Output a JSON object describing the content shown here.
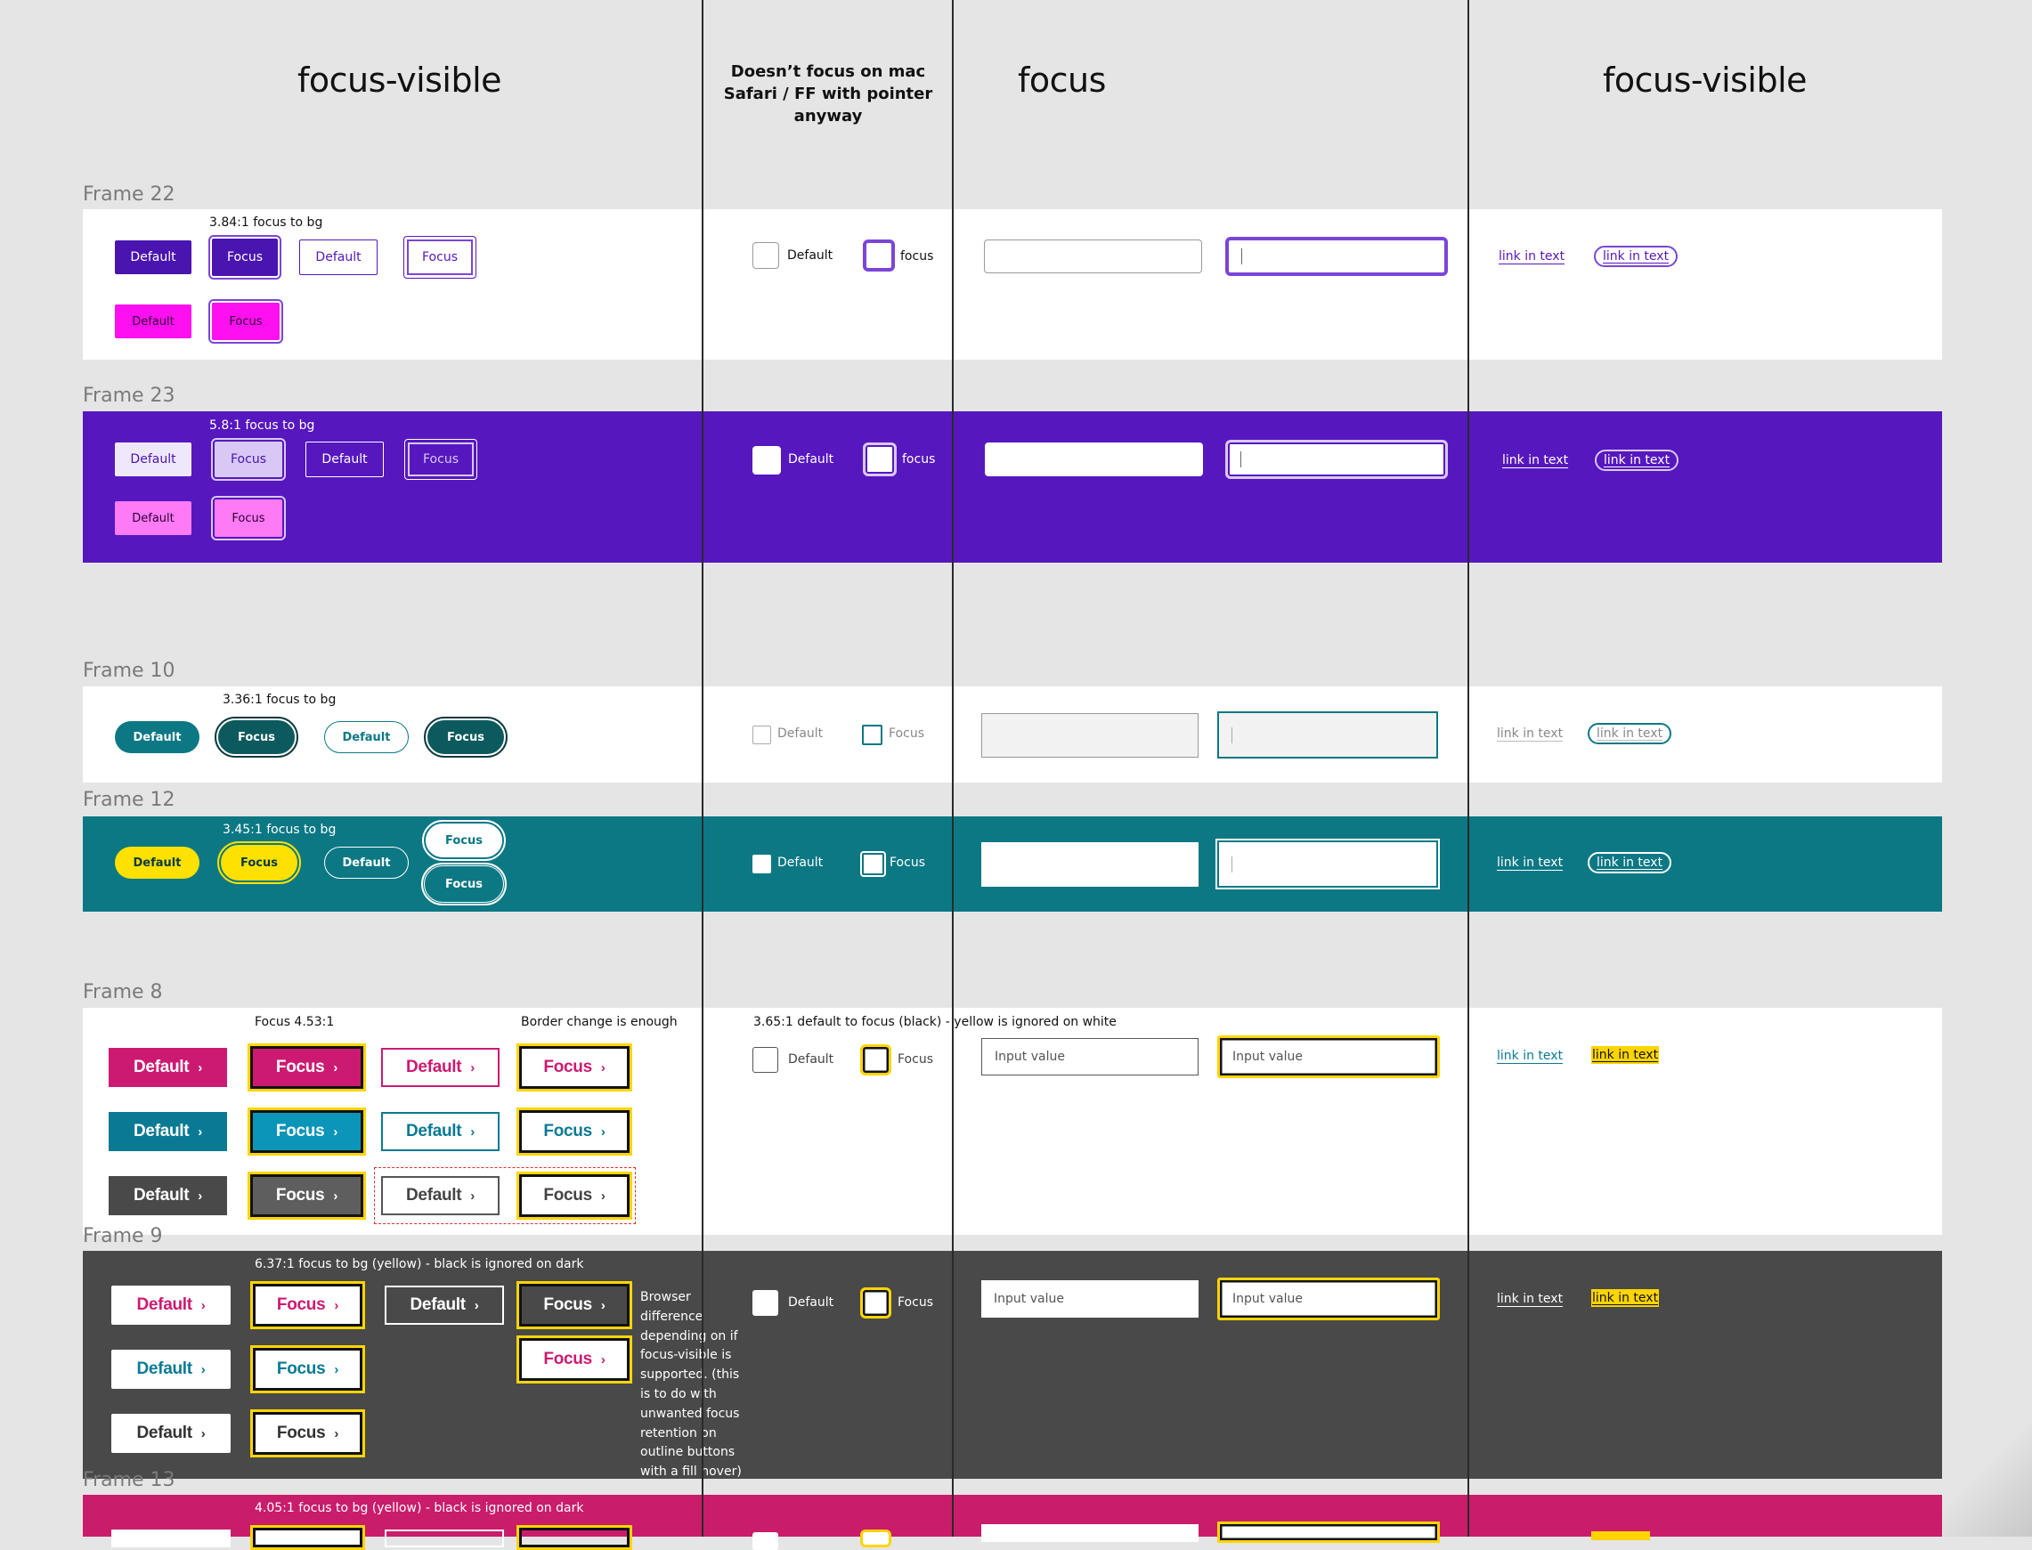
{
  "headers": {
    "col1": "focus-visible",
    "col2": "Doesn’t focus on mac Safari / FF with pointer anyway",
    "col3": "focus",
    "col4": "focus-visible"
  },
  "frames": {
    "f22": {
      "label": "Frame 22",
      "note": "3.84:1 focus to bg",
      "buttons": [
        "Default",
        "Focus",
        "Default",
        "Focus",
        "Default",
        "Focus"
      ],
      "checkbox_default": "Default",
      "checkbox_focus": "focus",
      "links": [
        "link in text",
        "link in text"
      ]
    },
    "f23": {
      "label": "Frame 23",
      "note": "5.8:1 focus to bg",
      "buttons": [
        "Default",
        "Focus",
        "Default",
        "Focus",
        "Default",
        "Focus"
      ],
      "checkbox_default": "Default",
      "checkbox_focus": "focus",
      "links": [
        "link in text",
        "link in text"
      ]
    },
    "f10": {
      "label": "Frame 10",
      "note": "3.36:1 focus to bg",
      "buttons": [
        "Default",
        "Focus",
        "Default",
        "Focus"
      ],
      "checkbox_default": "Default",
      "checkbox_focus": "Focus",
      "links": [
        "link in text",
        "link in text"
      ]
    },
    "f12": {
      "label": "Frame 12",
      "note": "3.45:1 focus to bg",
      "buttons": [
        "Default",
        "Focus",
        "Default",
        "Focus",
        "Focus"
      ],
      "checkbox_default": "Default",
      "checkbox_focus": "Focus",
      "links": [
        "link in text",
        "link in text"
      ]
    },
    "f8": {
      "label": "Frame 8",
      "note_focus": "Focus 4.53:1",
      "note_border": "Border change is enough",
      "note_checkbox": "3.65:1 default to focus (black) - yellow is ignored on white",
      "buttons": [
        "Default",
        "Focus",
        "Default",
        "Focus",
        "Default",
        "Focus",
        "Default",
        "Focus",
        "Default",
        "Focus",
        "Default",
        "Focus"
      ],
      "checkbox_default": "Default",
      "checkbox_focus": "Focus",
      "input_value": "Input value",
      "links": [
        "link in text",
        "link in text"
      ]
    },
    "f9": {
      "label": "Frame 9",
      "note": "6.37:1 focus to bg (yellow) - black is ignored on dark",
      "buttons": [
        "Default",
        "Focus",
        "Default",
        "Focus",
        "Focus",
        "Default",
        "Focus",
        "Default",
        "Focus"
      ],
      "side_note": "Browser difference depending on if focus-visible is supported. (this is to do with unwanted focus retention on outline buttons with a fill hover)",
      "checkbox_default": "Default",
      "checkbox_focus": "Focus",
      "input_value": "Input value",
      "links": [
        "link in text",
        "link in text"
      ]
    },
    "f13": {
      "label": "Frame 13",
      "note": "4.05:1 focus to bg (yellow) - black is ignored on dark"
    }
  },
  "colors": {
    "purple": "#4a14b0",
    "purple_bg": "#5617bf",
    "magenta": "#ff10f0",
    "teal": "#0b7884",
    "teal_dark": "#0d5a5e",
    "yellow": "#ffd500",
    "pink": "#cc1a72",
    "blue": "#0a7a94",
    "dark_gray": "#494949",
    "frame13_pink": "#c91c6b"
  }
}
